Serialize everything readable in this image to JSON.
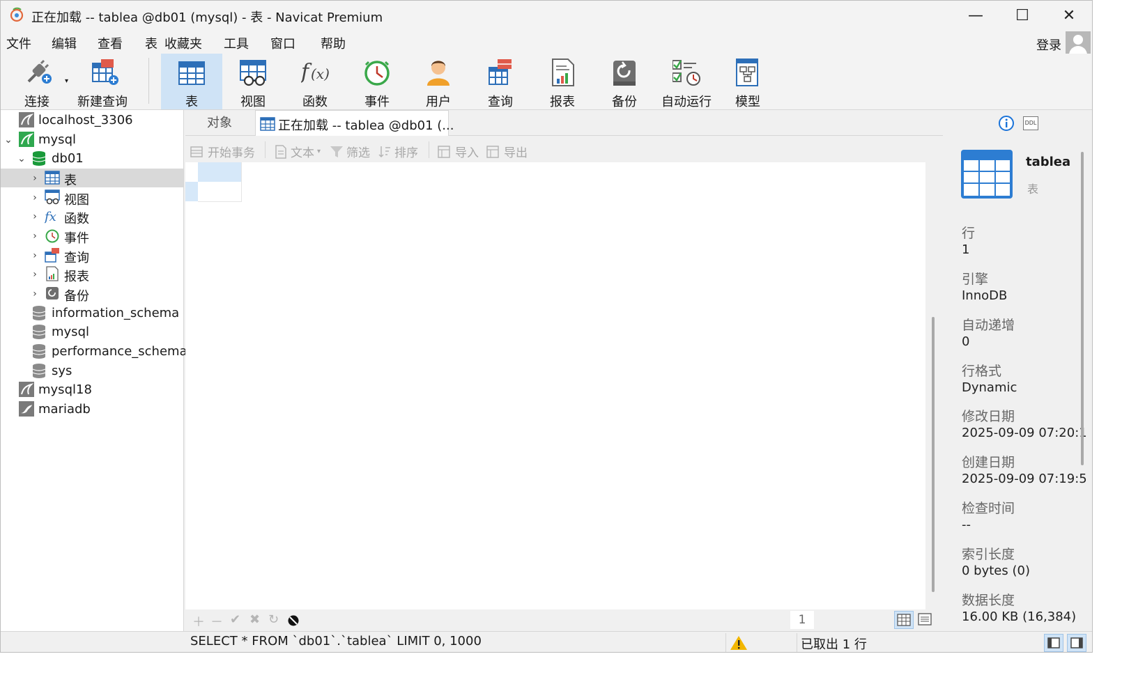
{
  "window": {
    "title": "正在加载 -- tablea @db01 (mysql) - 表 - Navicat Premium",
    "controls": {
      "minimize": "—",
      "maximize": "☐",
      "close": "✕"
    }
  },
  "menu": {
    "items": [
      "文件",
      "编辑",
      "查看",
      "表",
      "收藏夹",
      "工具",
      "窗口",
      "帮助"
    ],
    "login": "登录"
  },
  "toolbar": {
    "connect": "连接",
    "new_query": "新建查询",
    "buttons": [
      "表",
      "视图",
      "函数",
      "事件",
      "用户",
      "查询",
      "报表",
      "备份",
      "自动运行",
      "模型"
    ],
    "active": "表"
  },
  "tree": {
    "connections": [
      {
        "label": "localhost_3306"
      },
      {
        "label": "mysql",
        "expanded": true
      },
      {
        "label": "mysql18"
      },
      {
        "label": "mariadb"
      }
    ],
    "db01": "db01",
    "db01_children": [
      "表",
      "视图",
      "函数",
      "事件",
      "查询",
      "报表",
      "备份"
    ],
    "other_dbs": [
      "information_schema",
      "mysql",
      "performance_schema",
      "sys"
    ]
  },
  "tabs": {
    "objects": "对象",
    "active": "正在加载 -- tablea @db01 (..."
  },
  "subtoolbar": {
    "begin_tx": "开始事务",
    "text": "文本",
    "filter": "筛选",
    "sort": "排序",
    "import": "导入",
    "export": "导出"
  },
  "grid_footer": {
    "page": "1"
  },
  "info": {
    "table_name": "tablea",
    "table_type": "表",
    "fields": [
      {
        "key": "行",
        "value": "1"
      },
      {
        "key": "引擎",
        "value": "InnoDB"
      },
      {
        "key": "自动递增",
        "value": "0"
      },
      {
        "key": "行格式",
        "value": "Dynamic"
      },
      {
        "key": "修改日期",
        "value": "2025-09-09 07:20:1"
      },
      {
        "key": "创建日期",
        "value": "2025-09-09 07:19:5"
      },
      {
        "key": "检查时间",
        "value": "--"
      },
      {
        "key": "索引长度",
        "value": "0 bytes (0)"
      },
      {
        "key": "数据长度",
        "value": "16.00 KB (16,384)"
      }
    ],
    "ddl_label": "DDL"
  },
  "status": {
    "sql": "SELECT * FROM `db01`.`tablea` LIMIT 0, 1000",
    "fetched": "已取出 1 行"
  },
  "colors": {
    "accent": "#cfe3f6",
    "selection": "#d9d9d9",
    "db_green": "#1a9a3a",
    "info_blue": "#1a73d9"
  }
}
